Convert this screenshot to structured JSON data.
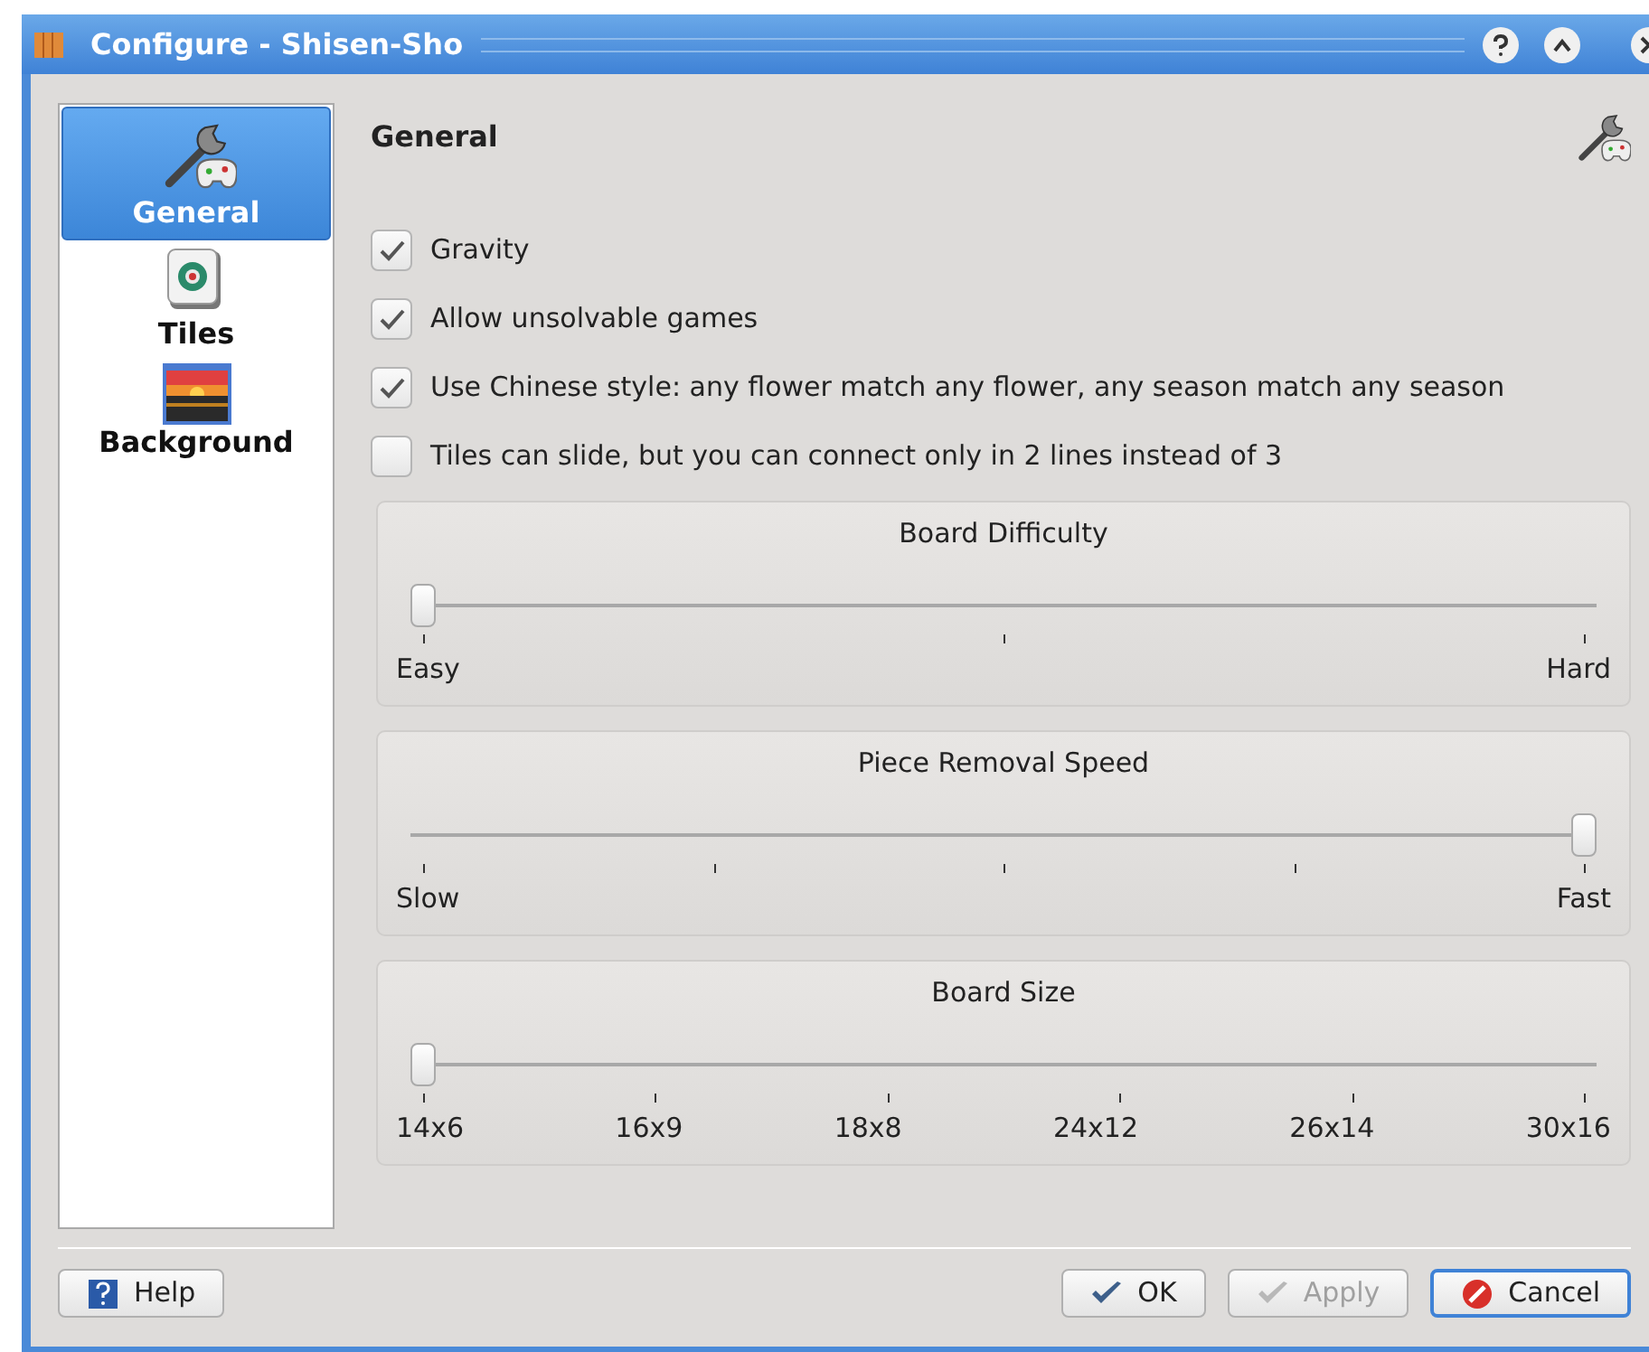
{
  "window": {
    "title": "Configure - Shisen-Sho"
  },
  "sidebar": {
    "items": [
      {
        "label": "General",
        "selected": true
      },
      {
        "label": "Tiles",
        "selected": false
      },
      {
        "label": "Background",
        "selected": false
      }
    ]
  },
  "page": {
    "title": "General"
  },
  "checkboxes": [
    {
      "label": "Gravity",
      "checked": true
    },
    {
      "label": "Allow unsolvable games",
      "checked": true
    },
    {
      "label": "Use Chinese style: any flower match any flower, any season match any season",
      "checked": true
    },
    {
      "label": "Tiles can slide, but you can connect only in 2 lines instead of 3",
      "checked": false
    }
  ],
  "sliders": [
    {
      "title": "Board Difficulty",
      "level": 0,
      "labels": [
        "Easy",
        "Hard"
      ]
    },
    {
      "title": "Piece Removal Speed",
      "level": 1,
      "labels": [
        "Slow",
        "Fast"
      ]
    },
    {
      "title": "Board Size",
      "level": 0,
      "labels": [
        "14x6",
        "16x9",
        "18x8",
        "24x12",
        "26x14",
        "30x16"
      ]
    }
  ],
  "buttons": [
    {
      "label": "Help",
      "disabled": false,
      "default": false
    },
    {
      "label": "OK",
      "disabled": false,
      "default": false
    },
    {
      "label": "Apply",
      "disabled": true,
      "default": false
    },
    {
      "label": "Cancel",
      "disabled": false,
      "default": true
    }
  ]
}
